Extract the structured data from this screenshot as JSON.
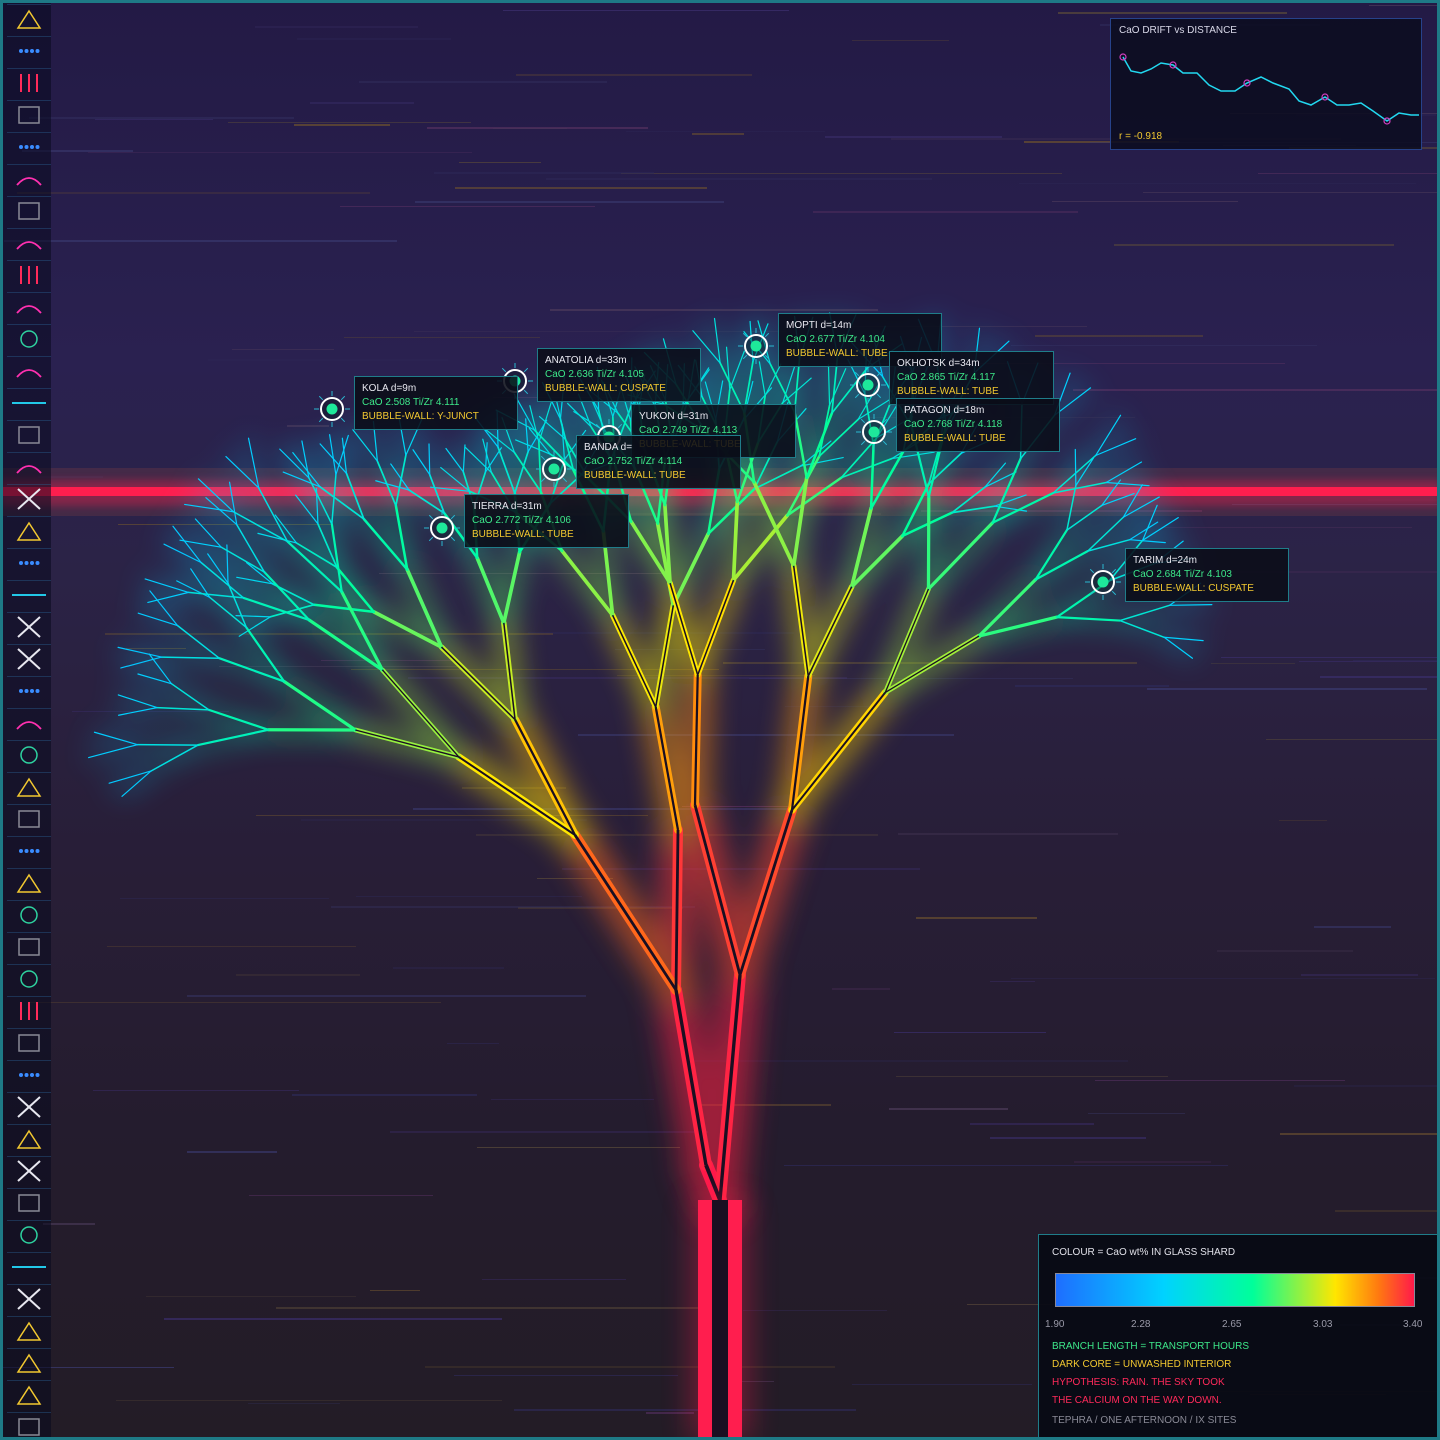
{
  "sidebar": {
    "icons": [
      "triangle-icon",
      "dots-icon",
      "bars-icon",
      "square-icon",
      "dots-icon",
      "arc-icon",
      "square-icon",
      "arc-icon",
      "bars-icon",
      "arc-icon",
      "circle-icon",
      "arc-icon",
      "dash-icon",
      "square-icon",
      "arc-icon",
      "cross-icon",
      "triangle-icon",
      "dots-icon",
      "dash-icon",
      "cross-icon",
      "cross-icon",
      "dots-icon",
      "arc-icon",
      "circle-icon",
      "triangle-icon",
      "square-icon",
      "dots-icon",
      "triangle-icon",
      "circle-icon",
      "square-icon",
      "circle-icon",
      "bars-icon",
      "square-icon",
      "dots-icon",
      "cross-icon",
      "triangle-icon",
      "cross-icon",
      "square-icon",
      "circle-icon",
      "dash-icon",
      "cross-icon",
      "triangle-icon",
      "triangle-icon",
      "triangle-icon",
      "square-icon"
    ],
    "colors": {
      "triangle-icon": "#f2c830",
      "dots-icon": "#3a8cff",
      "bars-icon": "#ff2a5a",
      "square-icon": "#8a8a96",
      "arc-icon": "#ff30b0",
      "circle-icon": "#2ed3a0",
      "dash-icon": "#22c8e8",
      "cross-icon": "#e8e8f0"
    }
  },
  "inset": {
    "title": "CaO DRIFT vs DISTANCE",
    "r_value": "r = -0.918",
    "line_color": "#22d8f0",
    "marker_color": "#d040c0"
  },
  "sites": [
    {
      "name": "KOLA d=9m",
      "cao": "CaO 2.508  Ti/Zr 4.111",
      "wall": "BUBBLE-WALL: Y-JUNCT"
    },
    {
      "name": "ANATOLIA d=33m",
      "cao": "CaO 2.636  Ti/Zr 4.105",
      "wall": "BUBBLE-WALL: CUSPATE"
    },
    {
      "name": "MOPTI d=14m",
      "cao": "CaO 2.677  Ti/Zr 4.104",
      "wall": "BUBBLE-WALL: TUBE"
    },
    {
      "name": "OKHOTSK d=34m",
      "cao": "CaO 2.865  Ti/Zr 4.117",
      "wall": "BUBBLE-WALL: TUBE"
    },
    {
      "name": "PATAGON d=18m",
      "cao": "CaO 2.768  Ti/Zr 4.118",
      "wall": "BUBBLE-WALL: TUBE"
    },
    {
      "name": "YUKON d=31m",
      "cao": "CaO 2.749  Ti/Zr 4.113",
      "wall": "BUBBLE-WALL: TUBE"
    },
    {
      "name": "BANDA d=",
      "cao": "CaO 2.752  Ti/Zr 4.114",
      "wall": "BUBBLE-WALL: TUBE"
    },
    {
      "name": "TIERRA d=31m",
      "cao": "CaO 2.772  Ti/Zr 4.106",
      "wall": "BUBBLE-WALL: TUBE"
    },
    {
      "name": "TARIM d=24m",
      "cao": "CaO 2.684  Ti/Zr 4.103",
      "wall": "BUBBLE-WALL: CUSPATE"
    }
  ],
  "legend": {
    "title": "COLOUR = CaO wt% IN GLASS SHARD",
    "ticks": [
      "1.90",
      "2.28",
      "2.65",
      "3.03",
      "3.40"
    ],
    "line1": "BRANCH LENGTH = TRANSPORT HOURS",
    "line2": "DARK CORE = UNWASHED INTERIOR",
    "line3": "HYPOTHESIS: RAIN. THE SKY TOOK",
    "line4": "THE CALCIUM ON THE WAY DOWN.",
    "line5": "TEPHRA / ONE AFTERNOON / IX SITES",
    "colors": {
      "line1": "#3de88a",
      "line2": "#f2c830",
      "line3": "#ff2a5a",
      "line4": "#ff2a5a",
      "line5": "#8a8a96"
    }
  },
  "colors": {
    "horizon_band": "#ff1e4e",
    "trunk": "#ff1e4e",
    "frame": "#1e7a86"
  }
}
